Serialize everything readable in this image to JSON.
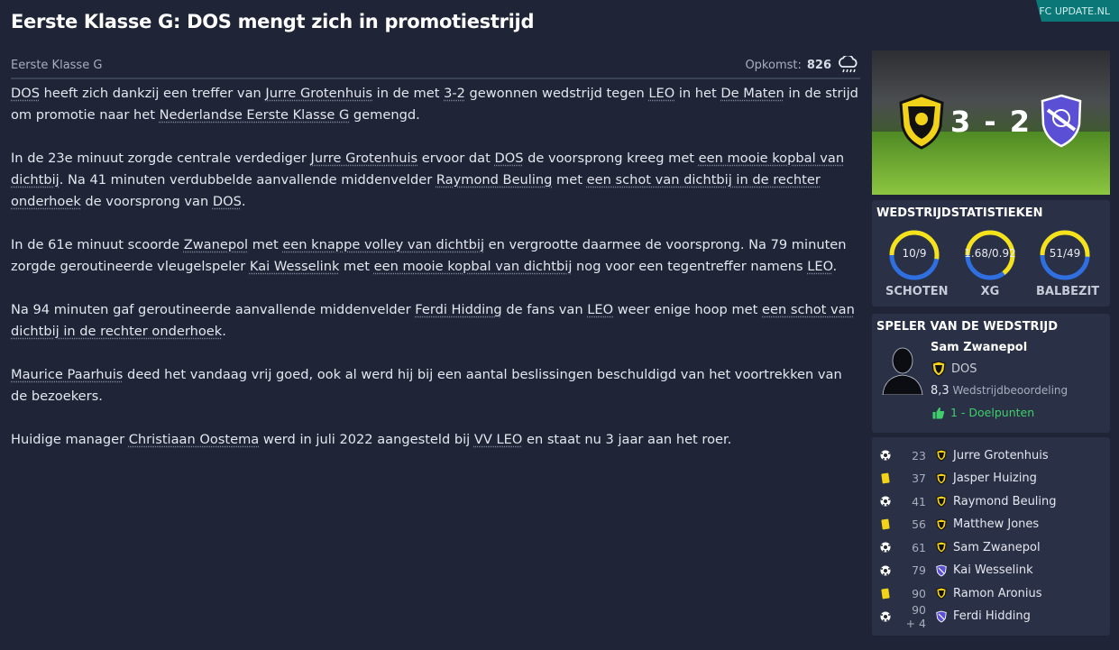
{
  "header": {
    "title": "Eerste Klasse G: DOS mengt zich in promotiestrijd",
    "brand": "FC UPDATE.NL"
  },
  "meta": {
    "competition": "Eerste Klasse G",
    "attendance_label": "Opkomst:",
    "attendance_value": "826",
    "weather_icon": "cloud-rain-icon"
  },
  "article": {
    "p1": {
      "a": "DOS",
      "b": " heeft zich dankzij een treffer van ",
      "c": "Jurre Grotenhuis",
      "d": " in de met ",
      "e": "3-2",
      "f": " gewonnen wedstrijd tegen ",
      "g": "LEO",
      "h": " in het ",
      "i": "De Maten",
      "j": " in de strijd om promotie naar het ",
      "k": "Nederlandse Eerste Klasse G",
      "l": " gemengd."
    },
    "p2": {
      "a": "In de 23e minuut zorgde centrale verdediger ",
      "b": "Jurre Grotenhuis",
      "c": " ervoor dat ",
      "d": "DOS",
      "e": " de voorsprong kreeg met ",
      "f": "een mooie kopbal van dichtbij",
      "g": ". Na 41 minuten verdubbelde aanvallende middenvelder ",
      "h": "Raymond Beuling",
      "i": " met ",
      "j": "een schot van dichtbij in de rechter onderhoek",
      "k": " de voorsprong van ",
      "l": "DOS",
      "m": "."
    },
    "p3": {
      "a": "In de 61e minuut scoorde ",
      "b": "Zwanepol",
      "c": " met ",
      "d": "een knappe volley van dichtbij",
      "e": " en vergrootte daarmee de voorsprong. Na 79 minuten zorgde geroutineerde vleugelspeler ",
      "f": "Kai Wesselink",
      "g": " met ",
      "h": "een mooie kopbal van dichtbij",
      "i": " nog voor een tegentreffer namens ",
      "j": "LEO",
      "k": "."
    },
    "p4": {
      "a": "Na 94 minuten gaf geroutineerde aanvallende middenvelder ",
      "b": "Ferdi Hidding",
      "c": " de fans van ",
      "d": "LEO",
      "e": " weer enige hoop met ",
      "f": "een schot van dichtbij in de rechter onderhoek",
      "g": "."
    },
    "p5": {
      "a": "Maurice Paarhuis",
      "b": " deed het vandaag vrij goed, ook al werd hij bij een aantal beslissingen beschuldigd van het voortrekken van de bezoekers."
    },
    "p6": {
      "a": "Huidige manager ",
      "b": "Christiaan Oostema",
      "c": " werd in juli 2022 aangesteld bij ",
      "d": "VV LEO",
      "e": " en staat nu 3 jaar aan het roer."
    }
  },
  "scoreboard": {
    "score": "3 - 2",
    "home_club": "DOS",
    "away_club": "LEO",
    "home_crest_color": "#f3d21a",
    "away_crest_color": "#5b4fd6"
  },
  "stats": {
    "title": "WEDSTRIJDSTATISTIEKEN",
    "home_color": "#f5e21a",
    "away_color": "#2f6fe0",
    "items": [
      {
        "label": "SCHOTEN",
        "value": "10/9",
        "home_share": 0.526
      },
      {
        "label": "XG",
        "value": "1.68/0.92",
        "home_share": 0.646
      },
      {
        "label": "BALBEZIT",
        "value": "51/49",
        "home_share": 0.51
      }
    ]
  },
  "motm": {
    "title": "SPELER VAN DE WEDSTRIJD",
    "name": "Sam Zwanepol",
    "club": "DOS",
    "rating": "8,3",
    "rating_label": "Wedstrijdbeoordeling",
    "goals": "1 - Doelpunten"
  },
  "events": [
    {
      "type": "goal",
      "icon": "football-icon",
      "minute": "23",
      "club": "DOS",
      "player": "Jurre Grotenhuis"
    },
    {
      "type": "yellow",
      "icon": "yellow-card-icon",
      "minute": "37",
      "club": "DOS",
      "player": "Jasper Huizing"
    },
    {
      "type": "goal",
      "icon": "football-icon",
      "minute": "41",
      "club": "DOS",
      "player": "Raymond Beuling"
    },
    {
      "type": "yellow",
      "icon": "yellow-card-icon",
      "minute": "56",
      "club": "DOS",
      "player": "Matthew Jones"
    },
    {
      "type": "goal",
      "icon": "football-icon",
      "minute": "61",
      "club": "DOS",
      "player": "Sam Zwanepol"
    },
    {
      "type": "goal",
      "icon": "football-icon",
      "minute": "79",
      "club": "LEO",
      "player": "Kai Wesselink"
    },
    {
      "type": "yellow",
      "icon": "yellow-card-icon",
      "minute": "90",
      "club": "DOS",
      "player": "Ramon Aronius"
    },
    {
      "type": "goal",
      "icon": "football-icon",
      "minute": "90 + 4",
      "club": "LEO",
      "player": "Ferdi Hidding"
    }
  ]
}
